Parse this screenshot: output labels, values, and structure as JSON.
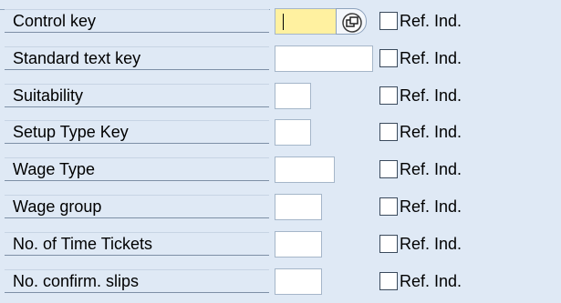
{
  "rows": [
    {
      "label": "Control key",
      "field_value": "",
      "checkbox_label": "Ref. Ind.",
      "checked": false,
      "required": true
    },
    {
      "label": "Standard text key",
      "field_value": "",
      "checkbox_label": "Ref. Ind.",
      "checked": false,
      "required": false
    },
    {
      "label": "Suitability",
      "field_value": "",
      "checkbox_label": "Ref. Ind.",
      "checked": false,
      "required": false
    },
    {
      "label": "Setup Type Key",
      "field_value": "",
      "checkbox_label": "Ref. Ind.",
      "checked": false,
      "required": false
    },
    {
      "label": "Wage Type",
      "field_value": "",
      "checkbox_label": "Ref. Ind.",
      "checked": false,
      "required": false
    },
    {
      "label": "Wage group",
      "field_value": "",
      "checkbox_label": "Ref. Ind.",
      "checked": false,
      "required": false
    },
    {
      "label": "No. of Time Tickets",
      "field_value": "",
      "checkbox_label": "Ref. Ind.",
      "checked": false,
      "required": false
    },
    {
      "label": "No. confirm. slips",
      "field_value": "",
      "checkbox_label": "Ref. Ind.",
      "checked": false,
      "required": false
    }
  ],
  "icons": {
    "value_help": "value-help-icon"
  },
  "colors": {
    "background": "#dfe9f5",
    "required_field": "#fff1a0",
    "label_border": "#7d8fa6"
  }
}
